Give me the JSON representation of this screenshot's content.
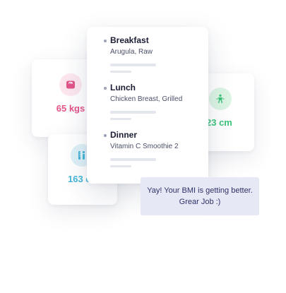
{
  "stats": {
    "weight": {
      "value": "65 kgs",
      "icon": "scale-icon",
      "color": "#e2548a"
    },
    "waist": {
      "value": "23 cm",
      "icon": "waist-icon",
      "color": "#3cc47a"
    },
    "height": {
      "value": "163 c",
      "icon": "height-icon",
      "color": "#45b7d8"
    }
  },
  "meals": [
    {
      "title": "Breakfast",
      "description": "Arugula, Raw"
    },
    {
      "title": "Lunch",
      "description": "Chicken Breast, Grilled"
    },
    {
      "title": "Dinner",
      "description": "Vitamin C Smoothie 2"
    }
  ],
  "message": {
    "text": "Yay! Your BMI is getting better. Grear Job :)"
  },
  "colors": {
    "message_background": "#e6e8f6",
    "title_text": "#1a1d33"
  }
}
